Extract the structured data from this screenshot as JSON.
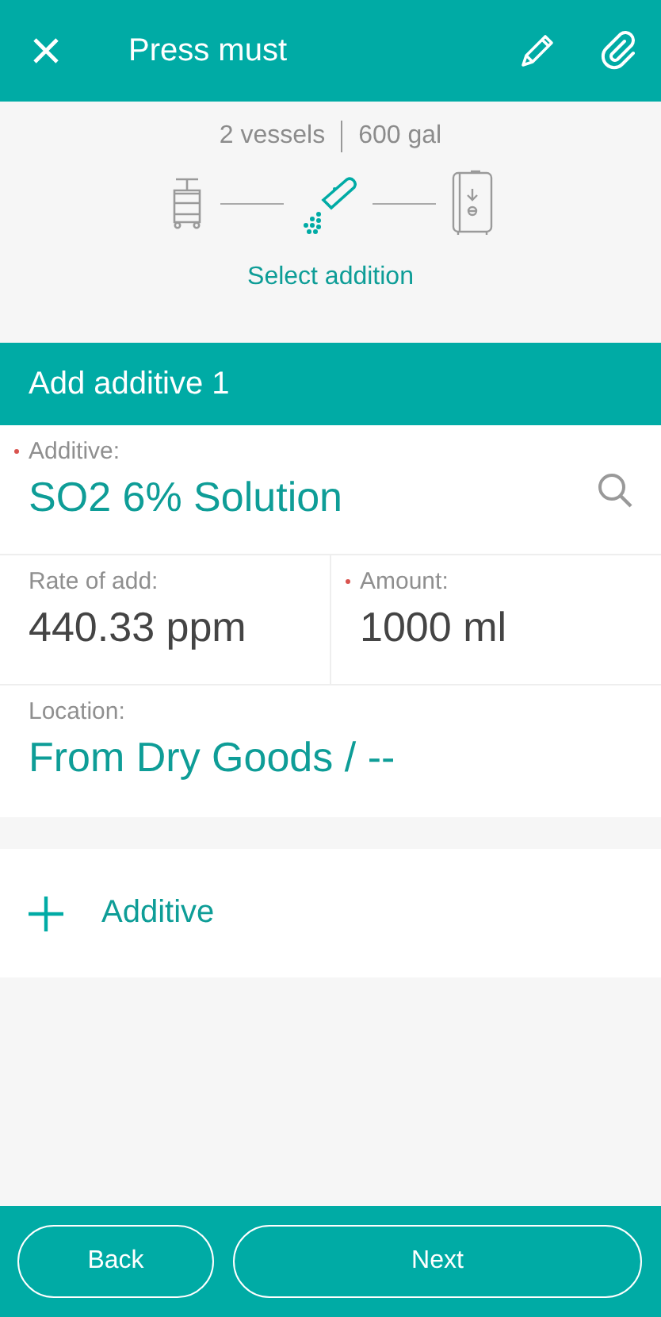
{
  "app_bar": {
    "title": "Press must"
  },
  "summary": {
    "vessels": "2 vessels",
    "volume": "600 gal",
    "step_label": "Select addition",
    "steps": [
      {
        "kind": "press",
        "selected": false
      },
      {
        "kind": "addition",
        "selected": true
      },
      {
        "kind": "tank",
        "selected": false
      }
    ]
  },
  "section": {
    "title": "Add additive 1"
  },
  "rows": [
    [
      {
        "label": "Additive:",
        "value": "SO2 6% Solution",
        "required": true,
        "kind": "picker",
        "search": true
      }
    ],
    [
      {
        "label": "Rate of add:",
        "value": "440.33 ppm",
        "required": false,
        "kind": "number",
        "search": false
      },
      {
        "label": "Amount:",
        "value": "1000 ml",
        "required": true,
        "kind": "number",
        "search": false
      }
    ],
    [
      {
        "label": "Location:",
        "value": "From Dry Goods / --",
        "required": false,
        "kind": "picker",
        "search": false
      }
    ]
  ],
  "add_button": {
    "label": "Additive"
  },
  "footer": {
    "buttons": [
      {
        "label": "Back"
      },
      {
        "label": "Next"
      }
    ]
  }
}
